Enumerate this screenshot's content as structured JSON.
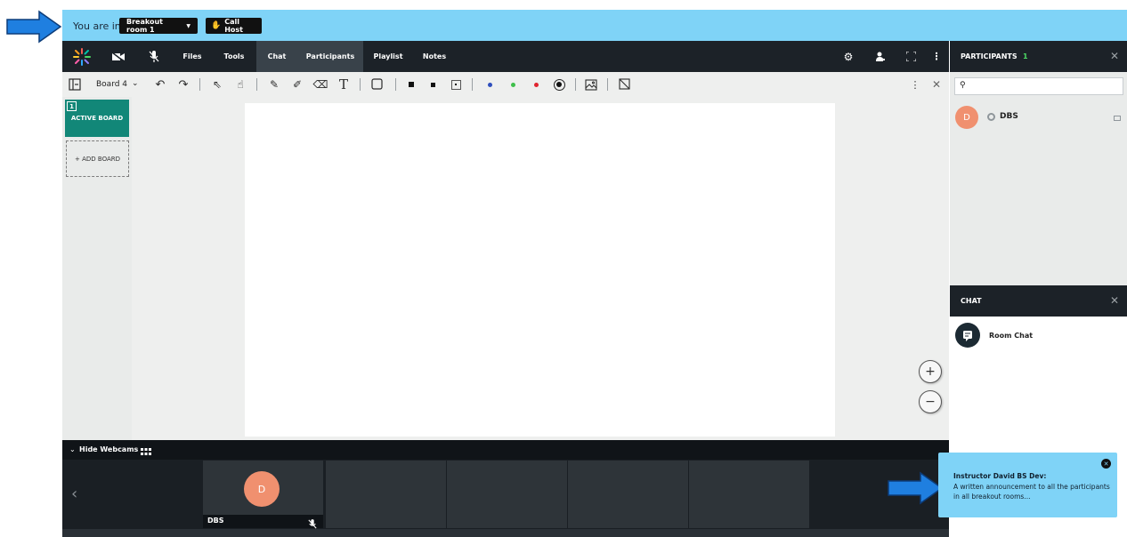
{
  "breakout_bar": {
    "you_are_in_label": "You are in:",
    "room_selected": "Breakout room 1",
    "call_host_label": "Call Host"
  },
  "topnav": {
    "items": [
      "Files",
      "Tools",
      "Chat",
      "Participants",
      "Playlist",
      "Notes"
    ],
    "active": "Chat"
  },
  "toolbar": {
    "board_name": "Board 4"
  },
  "boards": {
    "active_number": "1",
    "active_label": "ACTIVE BOARD",
    "add_label": "+ ADD BOARD"
  },
  "participants": {
    "title": "PARTICIPANTS",
    "count": "1",
    "search_placeholder": "",
    "list": [
      {
        "initial": "D",
        "name": "DBS"
      }
    ]
  },
  "chat": {
    "title": "CHAT",
    "rooms": [
      {
        "name": "Room Chat"
      }
    ]
  },
  "webcams": {
    "hide_label": "Hide Webcams",
    "tiles": [
      {
        "initial": "D",
        "name": "DBS"
      }
    ]
  },
  "notification": {
    "title": "Instructor David BS Dev:",
    "message": "A written announcement to all the participants in all breakout rooms..."
  },
  "colors": {
    "accent_blue": "#7fd3f7",
    "nav_dark": "#1c2228",
    "active_board": "#128778",
    "avatar": "#f0906f",
    "arrow_blue": "#1f7fe0"
  },
  "icons": {
    "toolbar": [
      "collapse-panel-icon",
      "undo-icon",
      "redo-icon",
      "select-arrow-icon",
      "pointer-hand-icon",
      "pen-icon",
      "marker-icon",
      "eraser-icon",
      "text-icon",
      "shape-icon",
      "stroke-large-icon",
      "stroke-medium-icon",
      "stroke-small-icon",
      "color-blue-icon",
      "color-green-icon",
      "color-red-icon",
      "color-picker-icon",
      "image-icon",
      "background-icon",
      "more-icon",
      "close-icon"
    ]
  }
}
